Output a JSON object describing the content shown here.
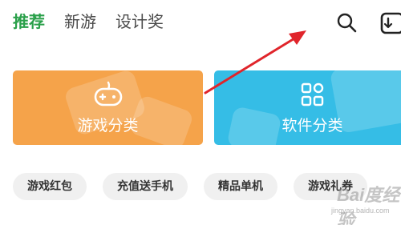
{
  "tabs": [
    {
      "label": "推荐",
      "active": true
    },
    {
      "label": "新游",
      "active": false
    },
    {
      "label": "设计奖",
      "active": false
    }
  ],
  "toolbar": {
    "search_icon": "search-icon",
    "download_icon": "download-manager-icon"
  },
  "categories": [
    {
      "label": "游戏分类",
      "icon": "gamepad-icon",
      "color": "#f5a34a"
    },
    {
      "label": "软件分类",
      "icon": "apps-grid-icon",
      "color": "#35bde6"
    }
  ],
  "chips": [
    {
      "label": "游戏红包"
    },
    {
      "label": "充值送手机"
    },
    {
      "label": "精品单机"
    },
    {
      "label": "游戏礼券"
    }
  ],
  "watermark": {
    "text": "Bai度经验",
    "sub": "jingyan.baidu.com"
  },
  "colors": {
    "accent": "#2aa04a",
    "annotation_arrow": "#e0252b"
  }
}
